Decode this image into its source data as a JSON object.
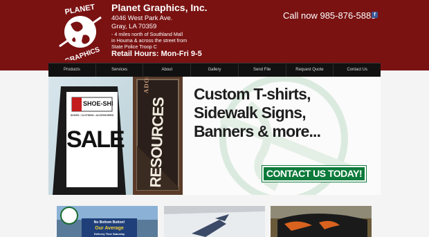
{
  "header": {
    "company": "Planet Graphics, Inc.",
    "address_lines": [
      "4046 West Park Ave.",
      "Gray, LA 70359"
    ],
    "directions_lines": [
      "- 4 miles north of Southland Mall",
      "in Houma & across the street from",
      "State Police Troop C"
    ],
    "hours": "Retail Hours:  Mon-Fri 9-5",
    "phone": "Call now 985-876-5885",
    "facebook_glyph": "f",
    "logo_text_top": "PLANET",
    "logo_text_bottom": "GRAPHICS"
  },
  "nav": {
    "items": [
      "Products",
      "Services",
      "About",
      "Gallery",
      "Send File",
      "Request Quote",
      "Contact Us"
    ]
  },
  "banner": {
    "headline_lines": [
      "Custom T-shirts,",
      "Sidewalk Signs,",
      "Banners & more..."
    ],
    "cta": "CONTACT US TODAY!",
    "sign_store": "SHOE-SHI",
    "sign_sub": "SHOES • CLOTHING • ACCESSORIES",
    "sign_sale": "SALE",
    "banner_word": "RESOURCES",
    "banner_top": "ADORA"
  },
  "thumbnails": {
    "items": [
      {
        "caption_a": "No Bottom Button!",
        "caption_b": "Our Average",
        "caption_c": "Delivery Time Saturday"
      }
    ]
  },
  "colors": {
    "header_bg": "#7a1212",
    "nav_bg": "#111111",
    "cta_bg": "#0c7a3a"
  }
}
